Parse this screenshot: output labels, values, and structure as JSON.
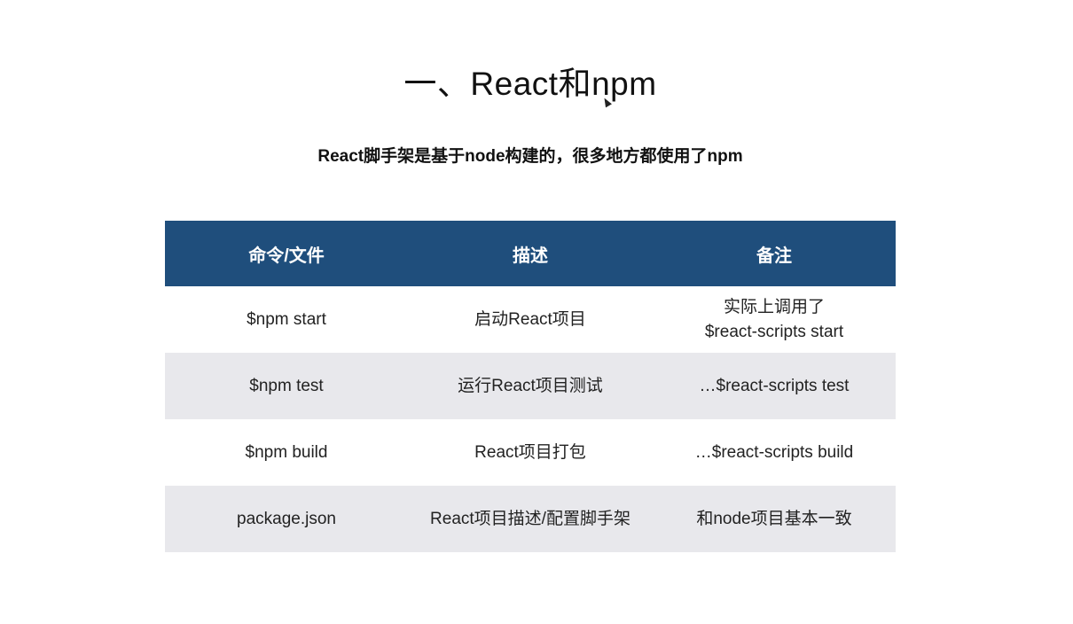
{
  "slide": {
    "title": "一、React和npm",
    "subtitle": "React脚手架是基于node构建的，很多地方都使用了npm"
  },
  "table": {
    "headers": [
      "命令/文件",
      "描述",
      "备注"
    ],
    "rows": [
      {
        "command": "$npm start",
        "description": "启动React项目",
        "note_line1": "实际上调用了",
        "note_line2": "$react-scripts start"
      },
      {
        "command": "$npm test",
        "description": "运行React项目测试",
        "note_line1": "…$react-scripts test",
        "note_line2": ""
      },
      {
        "command": "$npm build",
        "description": "React项目打包",
        "note_line1": "…$react-scripts build",
        "note_line2": ""
      },
      {
        "command": "package.json",
        "description": "React项目描述/配置脚手架",
        "note_line1": "和node项目基本一致",
        "note_line2": ""
      }
    ]
  },
  "colors": {
    "header_bg": "#1f4e7c",
    "header_text": "#ffffff",
    "alt_row_bg": "#e8e8ec"
  }
}
